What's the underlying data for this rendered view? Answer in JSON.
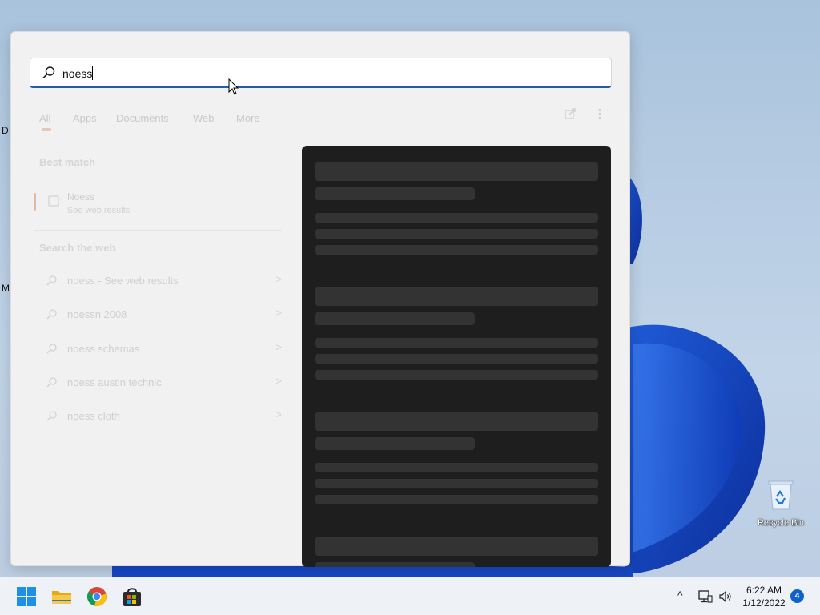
{
  "desktop": {
    "edge_labels": [
      "D",
      "M"
    ],
    "recycle_bin_label": "Recycle Bin"
  },
  "search": {
    "query": "noess"
  },
  "tabs": [
    {
      "label": "All",
      "active": true
    },
    {
      "label": "Apps"
    },
    {
      "label": "Documents"
    },
    {
      "label": "Web"
    },
    {
      "label": "More"
    }
  ],
  "tab_extras": {
    "share_icon": "share-icon",
    "more_icon": "more-options-icon"
  },
  "best_match": {
    "heading": "Best match",
    "title": "Noess",
    "subtitle": "See web results"
  },
  "web": {
    "heading": "Search the web",
    "items": [
      {
        "text": "noess - See web results",
        "arrow": ">"
      },
      {
        "text": "noessn 2008",
        "arrow": ">"
      },
      {
        "text": "noess schemas",
        "arrow": ">"
      },
      {
        "text": "noess austin technic",
        "arrow": ">"
      },
      {
        "text": "noess cloth",
        "arrow": ">"
      }
    ]
  },
  "taskbar": {
    "apps": [
      "start-icon",
      "file-explorer-icon",
      "chrome-icon",
      "store-icon"
    ],
    "tray_chevron": "^",
    "time": "6:22 AM",
    "date": "1/12/2022",
    "notification_count": "4"
  },
  "colors": {
    "accent": "#1e5fa6",
    "preview_bg": "#1e1e1e",
    "notification_badge": "#0e63c8"
  }
}
